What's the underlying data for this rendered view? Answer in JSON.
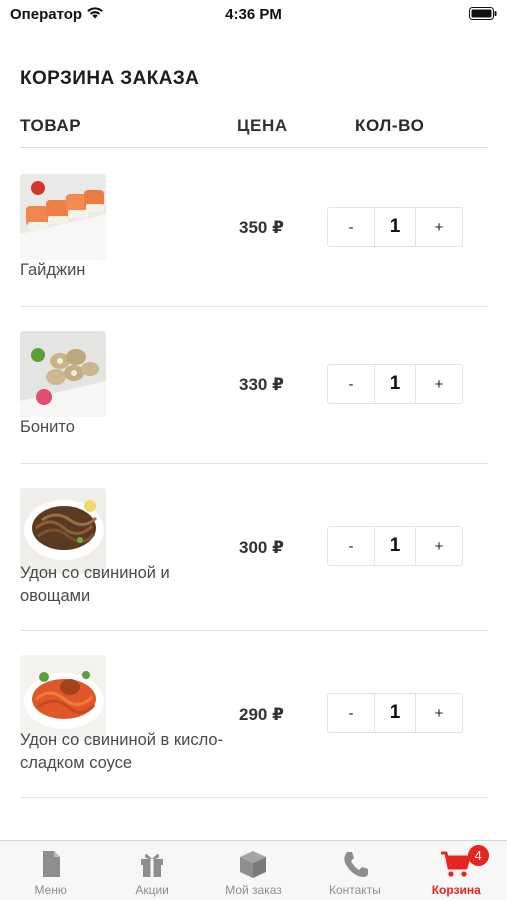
{
  "status_bar": {
    "carrier": "Оператор",
    "time": "4:36 PM"
  },
  "page": {
    "title": "КОРЗИНА ЗАКАЗА"
  },
  "cart": {
    "columns": {
      "product": "ТОВАР",
      "price": "ЦЕНА",
      "quantity": "КОЛ-ВО"
    },
    "stepper": {
      "minus": "-",
      "plus": "+"
    },
    "items": [
      {
        "name": "Гайджин",
        "price": "350 ₽",
        "quantity": "1"
      },
      {
        "name": "Бонито",
        "price": "330 ₽",
        "quantity": "1"
      },
      {
        "name": "Удон со свининой и овощами",
        "price": "300 ₽",
        "quantity": "1"
      },
      {
        "name": "Удон со свининой в кисло-сладком соусе",
        "price": "290 ₽",
        "quantity": "1"
      }
    ]
  },
  "tab_bar": {
    "tabs": [
      {
        "label": "Меню",
        "icon": "menu-document-icon"
      },
      {
        "label": "Акции",
        "icon": "gift-icon"
      },
      {
        "label": "Мой заказ",
        "icon": "box-icon"
      },
      {
        "label": "Контакты",
        "icon": "phone-icon"
      },
      {
        "label": "Корзина",
        "icon": "cart-icon",
        "active": true,
        "badge": "4"
      }
    ]
  },
  "colors": {
    "accent": "#e8241e",
    "inactive_tab": "#8e8e8e",
    "divider": "#e2e2e2"
  }
}
